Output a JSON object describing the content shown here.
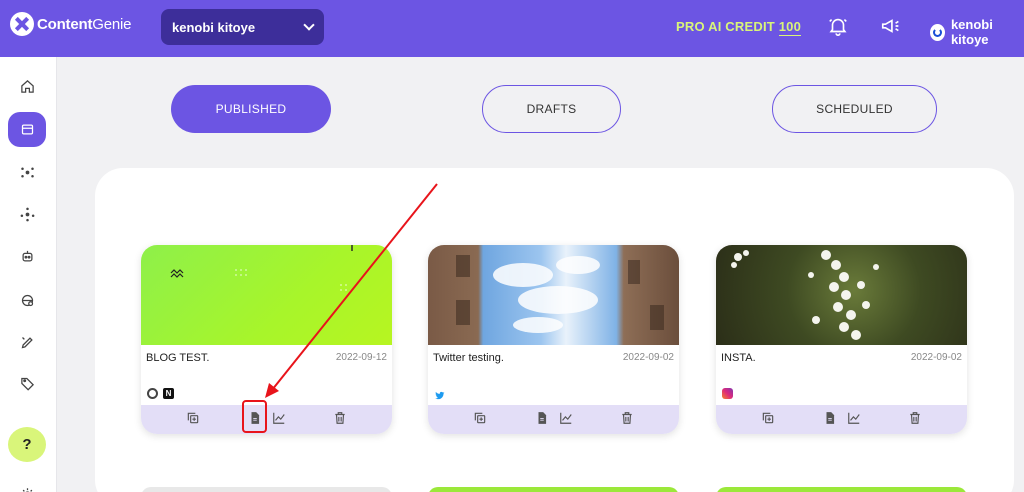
{
  "topbar": {
    "logo_bold": "Content",
    "logo_light": "Genie",
    "account_name": "kenobi kitoye",
    "credit_label": "PRO AI CREDIT",
    "credit_value": "100",
    "user_name": "kenobi kitoye"
  },
  "tabs": [
    {
      "label": "PUBLISHED",
      "active": true
    },
    {
      "label": "DRAFTS",
      "active": false
    },
    {
      "label": "SCHEDULED",
      "active": false
    }
  ],
  "sidebar": {
    "items": [
      "home-icon",
      "store-icon",
      "network-icon",
      "hub-icon",
      "robot-icon",
      "globe-icon",
      "pen-icon",
      "tag-icon"
    ],
    "help_label": "?"
  },
  "posts": [
    {
      "title": "BLOG TEST.",
      "date": "2022-09-12",
      "platforms": [
        "wordpress-icon",
        "notion-icon"
      ]
    },
    {
      "title": "Twitter testing.",
      "date": "2022-09-02",
      "platforms": [
        "twitter-icon"
      ]
    },
    {
      "title": "INSTA.",
      "date": "2022-09-02",
      "platforms": [
        "instagram-icon"
      ]
    }
  ],
  "colors": {
    "brand": "#6c55e3",
    "accent": "#d9f57a",
    "action_bar": "#e3def7",
    "annotation": "#e8141b"
  }
}
